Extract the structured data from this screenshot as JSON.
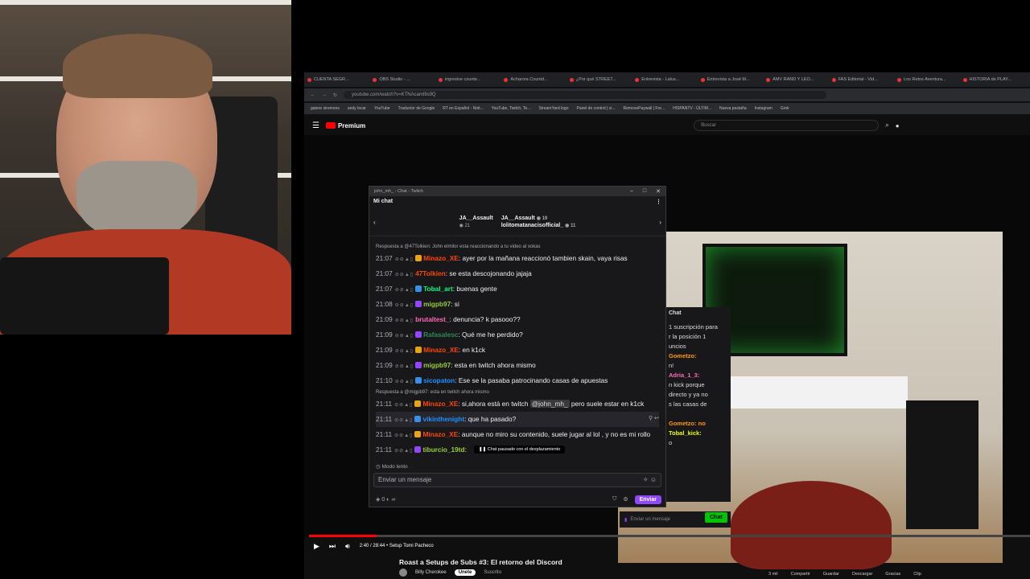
{
  "browser": {
    "tabs": [
      "CUENTA SEGR...",
      "OBS Studio - ...",
      "ingresive counte...",
      "Acharora Countd...",
      "¿Por qué STREET...",
      "Entrevista - Lalus...",
      "Entrevista a José M...",
      "AMV RAND Y LEO...",
      "FAS Editorial - Vid...",
      "Los Retos Aventura...",
      "HISTORIA de PLAY..."
    ],
    "url": "youtube.com/watch?v=KTNAcaml9s9Q",
    "bookmarks": [
      "gatere siremons",
      "andy lecar",
      "YouTube",
      "Traductor de Google",
      "RT en Español - Noti...",
      "YouTube, Twitch, Te...",
      "StreamYard logo",
      "Panel de control | vi...",
      "RemovePaywall | Fre...",
      "HISPANTV - ÚLTIM...",
      "Nueva pestaña",
      "Instagram",
      "Grok"
    ]
  },
  "youtube": {
    "logo": "Premium",
    "search_placeholder": "Buscar",
    "video_title": "Roast a Setups de Subs #3: El retorno del Discord",
    "channel": "Billy Cherokee",
    "subscribe": "Únete",
    "subscribed": "Suscrito",
    "time": "2:40 / 28:44 • Setup Tomi Pacheco",
    "actions": [
      "3 mil",
      "Compartir",
      "Guardar",
      "Descargar",
      "Gracias",
      "Clip"
    ],
    "progress": 0.094
  },
  "chat": {
    "window_title": "john_mh_ - Chat - Twitch",
    "my_chat": "Mi chat",
    "channels": [
      {
        "name": "JA__Assault",
        "viewers": "21"
      },
      {
        "name": "JA__Assault",
        "viewers": "19",
        "second": "lolitomatanacisofficial_",
        "second_viewers": "11"
      }
    ],
    "top_reply": "Respuesta a @47Tolkien: John elmilor esta reaccionando a tu video al xokas",
    "messages": [
      {
        "ts": "21:07",
        "user": "Minazo_XE",
        "color": "#ff4500",
        "badge": "#e8a317",
        "text": ": ayer por la mañana reaccionó tambien skain, vaya risas"
      },
      {
        "ts": "21:07",
        "user": "47Tolkien",
        "color": "#ff4500",
        "badge": "",
        "text": ": se esta descojonando jajaja"
      },
      {
        "ts": "21:07",
        "user": "Tobal_art",
        "color": "#00ff7f",
        "badge": "#3a8ee6",
        "text": ": buenas gente"
      },
      {
        "ts": "21:08",
        "user": "migpb97",
        "color": "#9acd32",
        "badge": "#9147ff",
        "text": ": si"
      },
      {
        "ts": "21:09",
        "user": "brutaltest_",
        "color": "#ff69b4",
        "badge": "",
        "text": ": denuncia? k pasooo??"
      },
      {
        "ts": "21:09",
        "user": "Rafasalesc",
        "color": "#2e8b57",
        "badge": "#9147ff",
        "text": ": Qué me he perdido?"
      },
      {
        "ts": "21:09",
        "user": "Minazo_XE",
        "color": "#ff4500",
        "badge": "#e8a317",
        "text": ": en k1ck"
      },
      {
        "ts": "21:09",
        "user": "migpb97",
        "color": "#9acd32",
        "badge": "#9147ff",
        "text": ": esta en twitch ahora mismo"
      },
      {
        "ts": "21:10",
        "user": "sicopaton",
        "color": "#1e90ff",
        "badge": "#3a8ee6",
        "text": ": Ese se la pasaba patrocinando casas de apuestas"
      }
    ],
    "reply2": "Respuesta a @migpb97: esta en twitch ahora mismo",
    "msg_mention": {
      "ts": "21:11",
      "user": "Minazo_XE",
      "color": "#ff4500",
      "pre": ": si,ahora está en twitch ",
      "mention": "@john_mh_",
      "post": " pero suele estar en k1ck"
    },
    "msg_hl": {
      "ts": "21:11",
      "user": "vikinthenight",
      "color": "#1e90ff",
      "text": ": que ha pasado?"
    },
    "msg_last1": {
      "ts": "21:11",
      "user": "Minazo_XE",
      "color": "#ff4500",
      "text": ": aunque no miro su contenido, suele jugar al lol , y no es mi rollo"
    },
    "msg_last2": {
      "ts": "21:11",
      "user": "tiburcio_19td",
      "color": "#9acd32",
      "text": ": "
    },
    "paused": "Chat pausado con el desplazamiento",
    "slow_mode": "Modo lento",
    "input_placeholder": "Enviar un mensaje",
    "points": "0",
    "send": "Enviar"
  },
  "minichat": {
    "header": "Chat",
    "lines": [
      {
        "cls": "",
        "text": "1 suscripción para"
      },
      {
        "cls": "",
        "text": "r la posición 1"
      },
      {
        "cls": "",
        "text": "uncios"
      },
      {
        "cls": "u1",
        "text": "Gometzo:"
      },
      {
        "cls": "",
        "text": "n!"
      },
      {
        "cls": "u2",
        "text": "Adria_1_3:"
      },
      {
        "cls": "",
        "text": "n kick porque"
      },
      {
        "cls": "",
        "text": "directo y ya no"
      },
      {
        "cls": "",
        "text": "s las casas de"
      },
      {
        "cls": "",
        "text": ""
      },
      {
        "cls": "u1",
        "text": "Gometzo: no"
      },
      {
        "cls": "u3",
        "text": "Tobal_kick:"
      },
      {
        "cls": "",
        "text": "o"
      }
    ],
    "input": "Enviar un mensaje",
    "chat_btn": "Chat"
  }
}
